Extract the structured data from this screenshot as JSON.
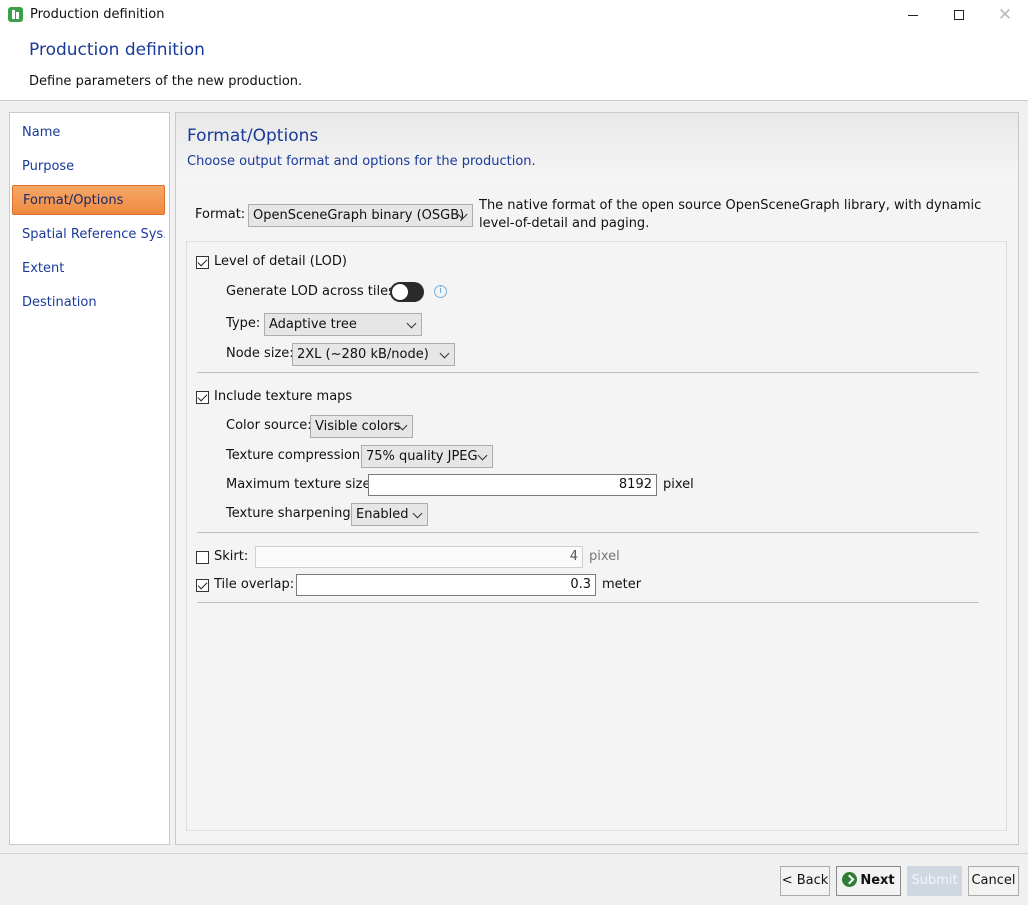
{
  "window": {
    "title": "Production definition"
  },
  "header": {
    "title": "Production definition",
    "description": "Define parameters of the new production."
  },
  "nav": {
    "items": [
      {
        "label": "Name"
      },
      {
        "label": "Purpose"
      },
      {
        "label": "Format/Options"
      },
      {
        "label": "Spatial Reference Sys..."
      },
      {
        "label": "Extent"
      },
      {
        "label": "Destination"
      }
    ],
    "active_index": 2
  },
  "page": {
    "title": "Format/Options",
    "description": "Choose output format and options for the production."
  },
  "format": {
    "label": "Format:",
    "value": "OpenSceneGraph binary (OSGB)",
    "description": "The native format of the open source OpenSceneGraph library, with dynamic level-of-detail and paging."
  },
  "lod": {
    "label": "Level of detail (LOD)",
    "checked": true,
    "generate_label": "Generate LOD across tiles:",
    "generate_on": false,
    "type_label": "Type:",
    "type_value": "Adaptive tree",
    "node_size_label": "Node size:",
    "node_size_value": "2XL (~280 kB/node)"
  },
  "texture": {
    "label": "Include texture maps",
    "checked": true,
    "color_source_label": "Color source:",
    "color_source_value": "Visible colors",
    "compression_label": "Texture compression:",
    "compression_value": "75% quality JPEG",
    "max_size_label": "Maximum texture size:",
    "max_size_value": "8192",
    "max_size_unit": "pixel",
    "sharpening_label": "Texture sharpening:",
    "sharpening_value": "Enabled"
  },
  "skirt": {
    "label": "Skirt:",
    "checked": false,
    "value": "4",
    "unit": "pixel"
  },
  "overlap": {
    "label": "Tile overlap:",
    "checked": true,
    "value": "0.3",
    "unit": "meter"
  },
  "footer": {
    "back_label": "< Back",
    "next_label": "Next",
    "submit_label": "Submit",
    "cancel_label": "Cancel"
  },
  "colors": {
    "accent_text": "#1a3a9a",
    "active_nav": "#ef8a3f"
  }
}
